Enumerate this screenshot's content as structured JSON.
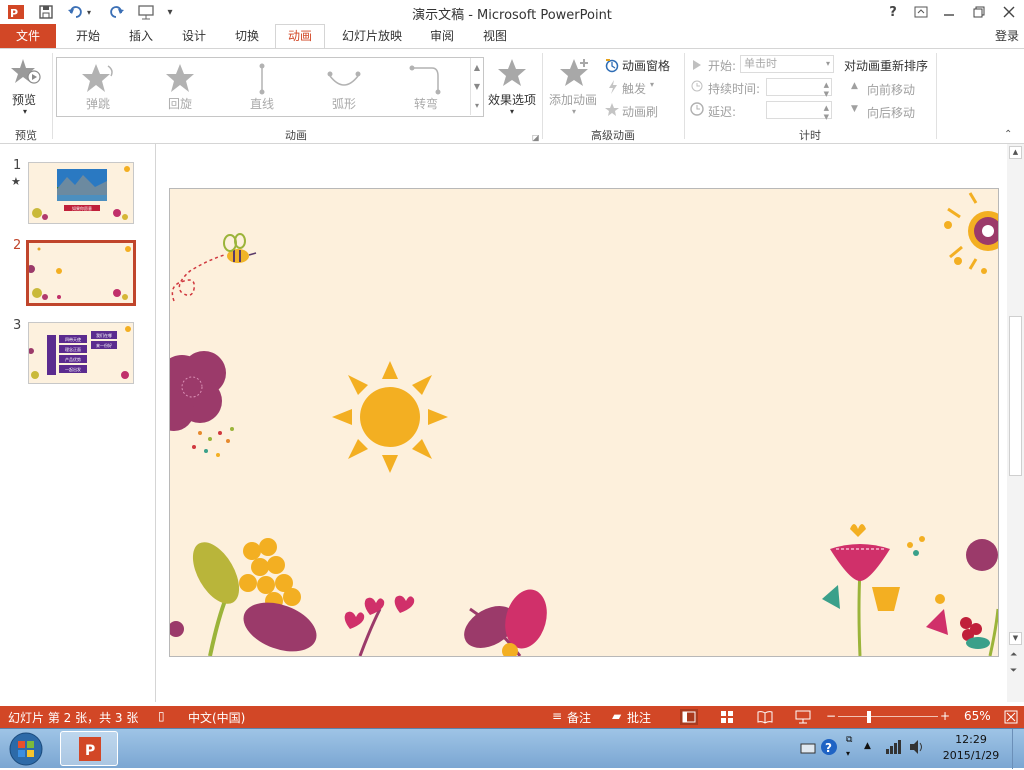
{
  "window": {
    "title": "演示文稿 - Microsoft PowerPoint",
    "help_label": "?",
    "login_label": "登录"
  },
  "quick_access": {
    "icons": [
      "powerpoint-logo-icon",
      "save-icon",
      "undo-icon",
      "redo-icon",
      "slideshow-icon",
      "customize-dropdown-icon"
    ]
  },
  "tabs": [
    {
      "id": "file",
      "label": "文件"
    },
    {
      "id": "home",
      "label": "开始"
    },
    {
      "id": "insert",
      "label": "插入"
    },
    {
      "id": "design",
      "label": "设计"
    },
    {
      "id": "transitions",
      "label": "切换"
    },
    {
      "id": "animations",
      "label": "动画"
    },
    {
      "id": "slideshow",
      "label": "幻灯片放映"
    },
    {
      "id": "review",
      "label": "审阅"
    },
    {
      "id": "view",
      "label": "视图"
    }
  ],
  "active_tab": "animations",
  "ribbon": {
    "preview": {
      "button_label": "预览",
      "group_label": "预览"
    },
    "animation_gallery": {
      "items": [
        {
          "label": "弹跳",
          "icon": "bounce-star-icon"
        },
        {
          "label": "回旋",
          "icon": "spin-star-icon"
        },
        {
          "label": "直线",
          "icon": "line-path-icon"
        },
        {
          "label": "弧形",
          "icon": "arc-path-icon"
        },
        {
          "label": "转弯",
          "icon": "turn-path-icon"
        }
      ],
      "effect_options_label": "效果选项",
      "group_label": "动画"
    },
    "advanced": {
      "add_animation_label": "添加动画",
      "animation_pane_label": "动画窗格",
      "trigger_label": "触发",
      "painter_label": "动画刷",
      "group_label": "高级动画"
    },
    "timing": {
      "start_label": "开始:",
      "start_value": "单击时",
      "duration_label": "持续时间:",
      "delay_label": "延迟:",
      "group_label": "计时"
    },
    "reorder": {
      "title": "对动画重新排序",
      "move_earlier": "向前移动",
      "move_later": "向后移动"
    }
  },
  "slides": [
    {
      "number": "1",
      "has_animation_star": true
    },
    {
      "number": "2",
      "selected": true
    },
    {
      "number": "3"
    }
  ],
  "thumb1_banner": "如果你愿意",
  "thumb3_lines": [
    "四带天使",
    "理念正面",
    "产品优势",
    "一起出发"
  ],
  "thumb3_right": [
    "我们在哪",
    "来一份好"
  ],
  "status": {
    "slide_info": "幻灯片 第 2 张，共 3 张",
    "language": "中文(中国)",
    "notes_label": "备注",
    "comments_label": "批注",
    "zoom_label": "65%",
    "zoom_level": 65
  },
  "taskbar": {
    "time": "12:29",
    "date": "2015/1/29"
  },
  "colors": {
    "accent": "#D24726",
    "slide_bg": "#FDF0DC",
    "sun": "#F3AF22"
  }
}
